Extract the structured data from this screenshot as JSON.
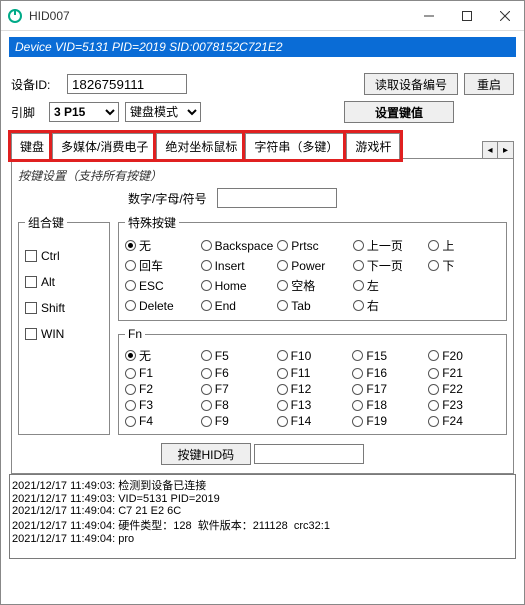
{
  "window": {
    "title": "HID007"
  },
  "device_string": "Device VID=5131 PID=2019  SID:0078152C721E2",
  "dev_id_label": "设备ID:",
  "dev_id_value": "1826759111",
  "btn_read_id": "读取设备编号",
  "btn_restart": "重启",
  "pin_label": "引脚",
  "pin_value": "3 P15",
  "kb_mode": "键盘模式",
  "btn_set_key": "设置键值",
  "tabs": {
    "t0": "键盘",
    "t1": "多媒体/消费电子",
    "t2": "绝对坐标鼠标",
    "t3": "字符串（多键）",
    "t4": "游戏杆"
  },
  "note": "按键设置（支持所有按键）",
  "char_label": "数字/字母/符号",
  "group_mod": "组合键",
  "mod": {
    "ctrl": "Ctrl",
    "alt": "Alt",
    "shift": "Shift",
    "win": "WIN"
  },
  "group_special": "特殊按键",
  "sp": {
    "none": "无",
    "enter": "回车",
    "esc": "ESC",
    "delete": "Delete",
    "backspace": "Backspace",
    "insert": "Insert",
    "home": "Home",
    "end": "End",
    "prtsc": "Prtsc",
    "power": "Power",
    "space": "空格",
    "tab": "Tab",
    "pgup": "上一页",
    "pgdn": "下一页",
    "left": "左",
    "right": "右",
    "up": "上",
    "down": "下"
  },
  "group_fn": "Fn",
  "fn": {
    "none": "无",
    "f1": "F1",
    "f2": "F2",
    "f3": "F3",
    "f4": "F4",
    "f5": "F5",
    "f6": "F6",
    "f7": "F7",
    "f8": "F8",
    "f9": "F9",
    "f10": "F10",
    "f11": "F11",
    "f12": "F12",
    "f13": "F13",
    "f14": "F14",
    "f15": "F15",
    "f16": "F16",
    "f17": "F17",
    "f18": "F18",
    "f19": "F19",
    "f20": "F20",
    "f21": "F21",
    "f22": "F22",
    "f23": "F23",
    "f24": "F24"
  },
  "btn_hid": "按键HID码",
  "log_text": "2021/12/17 11:49:03: 检测到设备已连接\n2021/12/17 11:49:03: VID=5131 PID=2019\n2021/12/17 11:49:04: C7 21 E2 6C\n2021/12/17 11:49:04: 硬件类型：128  软件版本：211128  crc32:1\n2021/12/17 11:49:04: pro"
}
